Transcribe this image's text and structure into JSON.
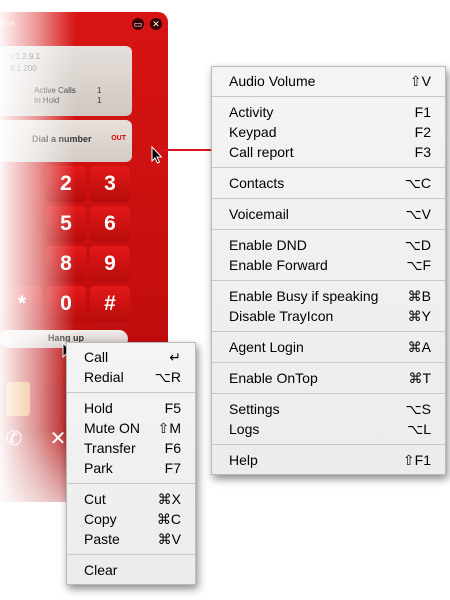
{
  "phone": {
    "title": "one",
    "version": "v.1.2.9.1",
    "ip": "8.1.200",
    "active_calls_label": "Active Calls",
    "active_calls_value": "1",
    "in_hold_label": "In Hold",
    "in_hold_value": "1",
    "dial_text": "Dial a number",
    "out_label": "OUT",
    "keys": [
      "2",
      "3",
      "5",
      "6",
      "8",
      "9",
      "*",
      "0",
      "#"
    ],
    "hangup_label": "Hang up",
    "accent_color": "#d01010"
  },
  "main_menu": {
    "groups": [
      [
        {
          "label": "Audio Volume",
          "shortcut": "⇧V"
        }
      ],
      [
        {
          "label": "Activity",
          "shortcut": "F1"
        },
        {
          "label": "Keypad",
          "shortcut": "F2"
        },
        {
          "label": "Call report",
          "shortcut": "F3"
        }
      ],
      [
        {
          "label": "Contacts",
          "shortcut": "⌥C"
        }
      ],
      [
        {
          "label": "Voicemail",
          "shortcut": "⌥V"
        }
      ],
      [
        {
          "label": "Enable DND",
          "shortcut": "⌥D"
        },
        {
          "label": "Enable Forward",
          "shortcut": "⌥F"
        }
      ],
      [
        {
          "label": "Enable Busy if speaking",
          "shortcut": "⌘B"
        },
        {
          "label": "Disable TrayIcon",
          "shortcut": "⌘Y"
        }
      ],
      [
        {
          "label": "Agent Login",
          "shortcut": "⌘A"
        }
      ],
      [
        {
          "label": "Enable OnTop",
          "shortcut": "⌘T"
        }
      ],
      [
        {
          "label": "Settings",
          "shortcut": "⌥S"
        },
        {
          "label": "Logs",
          "shortcut": "⌥L"
        }
      ],
      [
        {
          "label": "Help",
          "shortcut": "⇧F1"
        }
      ]
    ]
  },
  "context_menu": {
    "groups": [
      [
        {
          "label": "Call",
          "shortcut": "↵"
        },
        {
          "label": "Redial",
          "shortcut": "⌥R"
        }
      ],
      [
        {
          "label": "Hold",
          "shortcut": "F5"
        },
        {
          "label": "Mute ON",
          "shortcut": "⇧M"
        },
        {
          "label": "Transfer",
          "shortcut": "F6"
        },
        {
          "label": "Park",
          "shortcut": "F7"
        }
      ],
      [
        {
          "label": "Cut",
          "shortcut": "⌘X"
        },
        {
          "label": "Copy",
          "shortcut": "⌘C"
        },
        {
          "label": "Paste",
          "shortcut": "⌘V"
        }
      ],
      [
        {
          "label": "Clear",
          "shortcut": ""
        }
      ]
    ]
  }
}
